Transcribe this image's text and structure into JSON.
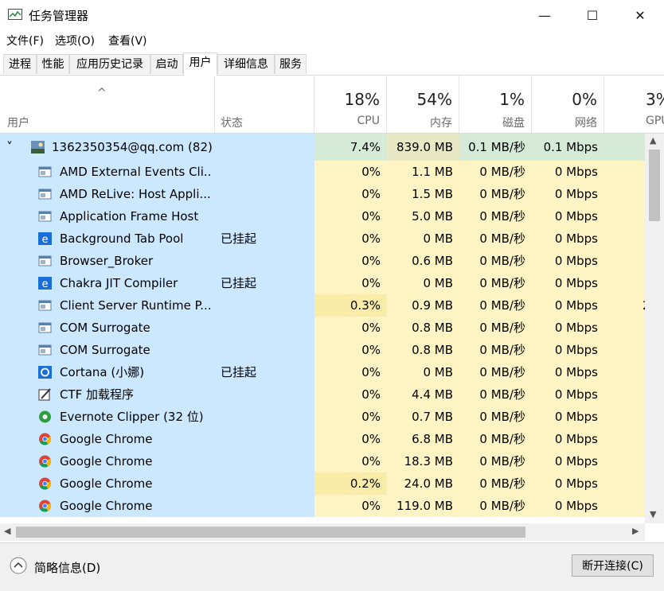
{
  "window": {
    "title": "任务管理器",
    "minimize": "—",
    "maximize": "☐",
    "close": "✕"
  },
  "menu": [
    "文件(F)",
    "选项(O)",
    "查看(V)"
  ],
  "tabs": [
    "进程",
    "性能",
    "应用历史记录",
    "启动",
    "用户",
    "详细信息",
    "服务"
  ],
  "active_tab": "用户",
  "header": {
    "sort_arrow": "^",
    "user": "用户",
    "status": "状态",
    "cpu": {
      "pct": "18%",
      "label": "CPU"
    },
    "memory": {
      "pct": "54%",
      "label": "内存"
    },
    "disk": {
      "pct": "1%",
      "label": "磁盘"
    },
    "network": {
      "pct": "0%",
      "label": "网络"
    },
    "gpu": {
      "pct": "3%",
      "label": "GPU"
    }
  },
  "group": {
    "chevron": "˅",
    "name": "1362350354@qq.com (82)",
    "cpu": "7.4%",
    "mem": "839.0 MB",
    "disk": "0.1 MB/秒",
    "net": "0.1 Mbps"
  },
  "rows": [
    {
      "icon": "window-icon",
      "name": "AMD External Events Cli...",
      "status": "",
      "cpu": "0%",
      "mem": "1.1 MB",
      "disk": "0 MB/秒",
      "net": "0 Mbps",
      "gpu": ""
    },
    {
      "icon": "window-icon",
      "name": "AMD ReLive: Host Appli...",
      "status": "",
      "cpu": "0%",
      "mem": "1.5 MB",
      "disk": "0 MB/秒",
      "net": "0 Mbps",
      "gpu": ""
    },
    {
      "icon": "window-icon",
      "name": "Application Frame Host",
      "status": "",
      "cpu": "0%",
      "mem": "5.0 MB",
      "disk": "0 MB/秒",
      "net": "0 Mbps",
      "gpu": ""
    },
    {
      "icon": "edge-icon",
      "name": "Background Tab Pool",
      "status": "已挂起",
      "cpu": "0%",
      "mem": "0 MB",
      "disk": "0 MB/秒",
      "net": "0 Mbps",
      "gpu": ""
    },
    {
      "icon": "window-icon",
      "name": "Browser_Broker",
      "status": "",
      "cpu": "0%",
      "mem": "0.6 MB",
      "disk": "0 MB/秒",
      "net": "0 Mbps",
      "gpu": ""
    },
    {
      "icon": "edge-icon",
      "name": "Chakra JIT Compiler",
      "status": "已挂起",
      "cpu": "0%",
      "mem": "0 MB",
      "disk": "0 MB/秒",
      "net": "0 Mbps",
      "gpu": ""
    },
    {
      "icon": "window-icon",
      "name": "Client Server Runtime P...",
      "status": "",
      "cpu": "0.3%",
      "mem": "0.9 MB",
      "disk": "0 MB/秒",
      "net": "0 Mbps",
      "gpu": "2"
    },
    {
      "icon": "window-icon",
      "name": "COM Surrogate",
      "status": "",
      "cpu": "0%",
      "mem": "0.8 MB",
      "disk": "0 MB/秒",
      "net": "0 Mbps",
      "gpu": ""
    },
    {
      "icon": "window-icon",
      "name": "COM Surrogate",
      "status": "",
      "cpu": "0%",
      "mem": "0.8 MB",
      "disk": "0 MB/秒",
      "net": "0 Mbps",
      "gpu": ""
    },
    {
      "icon": "cortana-icon",
      "name": "Cortana (小娜)",
      "status": "已挂起",
      "cpu": "0%",
      "mem": "0 MB",
      "disk": "0 MB/秒",
      "net": "0 Mbps",
      "gpu": ""
    },
    {
      "icon": "ctf-icon",
      "name": "CTF 加载程序",
      "status": "",
      "cpu": "0%",
      "mem": "4.4 MB",
      "disk": "0 MB/秒",
      "net": "0 Mbps",
      "gpu": ""
    },
    {
      "icon": "evernote-icon",
      "name": "Evernote Clipper (32 位)",
      "status": "",
      "cpu": "0%",
      "mem": "0.7 MB",
      "disk": "0 MB/秒",
      "net": "0 Mbps",
      "gpu": ""
    },
    {
      "icon": "chrome-icon",
      "name": "Google Chrome",
      "status": "",
      "cpu": "0%",
      "mem": "6.8 MB",
      "disk": "0 MB/秒",
      "net": "0 Mbps",
      "gpu": ""
    },
    {
      "icon": "chrome-icon",
      "name": "Google Chrome",
      "status": "",
      "cpu": "0%",
      "mem": "18.3 MB",
      "disk": "0 MB/秒",
      "net": "0 Mbps",
      "gpu": ""
    },
    {
      "icon": "chrome-icon",
      "name": "Google Chrome",
      "status": "",
      "cpu": "0.2%",
      "mem": "24.0 MB",
      "disk": "0 MB/秒",
      "net": "0 Mbps",
      "gpu": ""
    },
    {
      "icon": "chrome-icon",
      "name": "Google Chrome",
      "status": "",
      "cpu": "0%",
      "mem": "119.0 MB",
      "disk": "0 MB/秒",
      "net": "0 Mbps",
      "gpu": ""
    }
  ],
  "footer": {
    "toggle": "简略信息(D)",
    "disconnect": "断开连接(C)"
  },
  "colors": {
    "selected": "#cce8ff",
    "heat_light": "#fff4c4",
    "heat_mid": "#f9eca8"
  }
}
